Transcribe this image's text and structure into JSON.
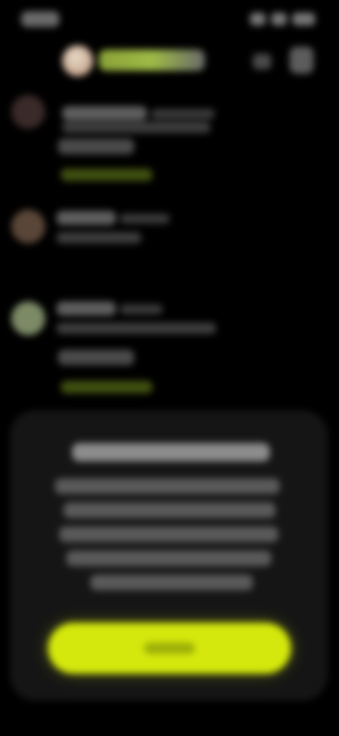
{
  "status_bar": {
    "time": ""
  },
  "header": {
    "title": ""
  },
  "feed": [
    {
      "name": "",
      "meta": "",
      "text": "",
      "stats": "",
      "link": ""
    },
    {
      "name": "",
      "meta": "",
      "text": ""
    },
    {
      "name": "",
      "meta": "",
      "text": "",
      "stats": "",
      "link": ""
    }
  ],
  "modal": {
    "title": "",
    "body_lines": [
      "",
      "",
      "",
      "",
      ""
    ],
    "cta": ""
  },
  "colors": {
    "background": "#000000",
    "accent": "#d4e80d",
    "modal_bg": "#151515"
  }
}
